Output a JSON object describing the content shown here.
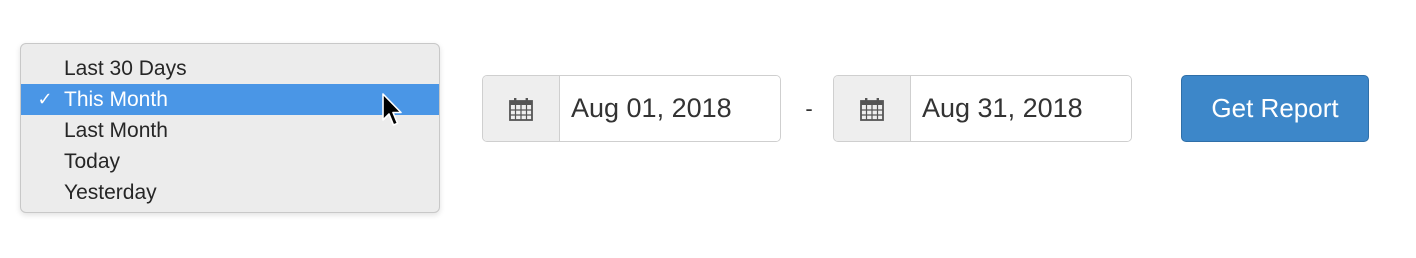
{
  "range_menu": {
    "items": [
      {
        "label": "Last 30 Days",
        "selected": false
      },
      {
        "label": "This Month",
        "selected": true
      },
      {
        "label": "Last Month",
        "selected": false
      },
      {
        "label": "Today",
        "selected": false
      },
      {
        "label": "Yesterday",
        "selected": false
      }
    ],
    "check_glyph": "✓",
    "selected_color": "#4a96e6"
  },
  "date_range": {
    "start": {
      "value": "Aug 01, 2018",
      "icon": "calendar-icon"
    },
    "separator": "-",
    "end": {
      "value": "Aug 31, 2018",
      "icon": "calendar-icon"
    }
  },
  "actions": {
    "get_report_label": "Get Report",
    "button_color": "#3d87c9"
  }
}
